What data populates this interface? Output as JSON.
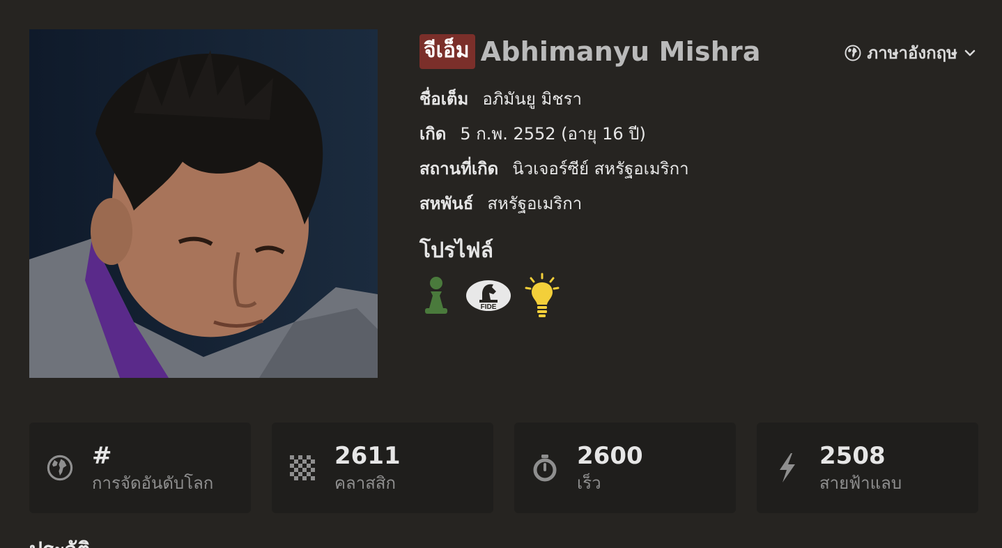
{
  "player": {
    "title": "จีเอ็ม",
    "name": "Abhimanyu Mishra"
  },
  "language": {
    "label": "ภาษาอังกฤษ",
    "icon": "globe-icon"
  },
  "facts": [
    {
      "key": "ชื่อเต็ม",
      "value": "อภิมันยู มิชรา"
    },
    {
      "key": "เกิด",
      "value": "5 ก.พ. 2552 (อายุ 16 ปี)"
    },
    {
      "key": "สถานที่เกิด",
      "value": "นิวเจอร์ซีย์ สหรัฐอเมริกา"
    },
    {
      "key": "สหพันธ์",
      "value": "สหรัฐอเมริกา"
    }
  ],
  "profiles": {
    "heading": "โปรไฟล์",
    "items": [
      {
        "icon": "chess-pawn-icon",
        "color": "#4a7a3c"
      },
      {
        "icon": "fide-logo-icon",
        "label": "FIDE"
      },
      {
        "icon": "lightbulb-icon",
        "color": "#f3cf3a"
      }
    ]
  },
  "ratings": [
    {
      "icon": "globe-icon",
      "value": "#",
      "label": "การจัดอันดับโลก"
    },
    {
      "icon": "checkerboard-icon",
      "value": "2611",
      "label": "คลาสสิก"
    },
    {
      "icon": "stopwatch-icon",
      "value": "2600",
      "label": "เร็ว"
    },
    {
      "icon": "lightning-icon",
      "value": "2508",
      "label": "สายฟ้าแลบ"
    }
  ],
  "history": {
    "heading": "ประวัติ"
  },
  "colors": {
    "background": "#262421",
    "card": "#1f1e1c",
    "title_badge": "#7b2f2a"
  }
}
